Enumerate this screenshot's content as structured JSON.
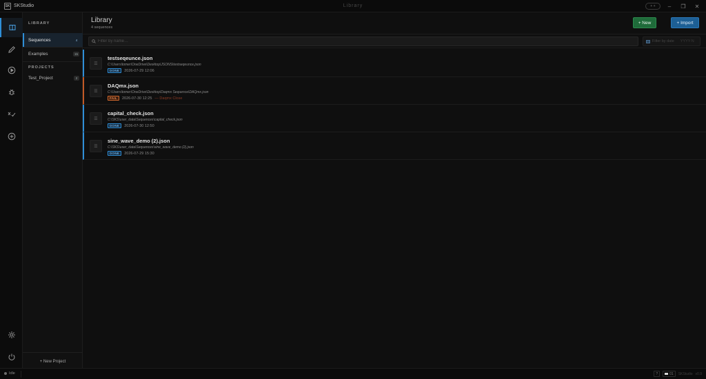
{
  "titlebar": {
    "app_logo": "SK",
    "app_name": "SKStudio",
    "window_title": "Library",
    "pill_label": "+ +",
    "minimize": "–",
    "restore": "❐",
    "close": "✕"
  },
  "rail": {
    "items": [
      {
        "name": "library",
        "icon": "book-icon"
      },
      {
        "name": "editor",
        "icon": "pencil-icon"
      },
      {
        "name": "run",
        "icon": "play-icon"
      },
      {
        "name": "debug",
        "icon": "bug-icon"
      },
      {
        "name": "test",
        "icon": "test-check-icon"
      },
      {
        "name": "add",
        "icon": "plus-circle-icon"
      },
      {
        "name": "settings",
        "icon": "gear-icon"
      },
      {
        "name": "power",
        "icon": "power-icon"
      }
    ]
  },
  "sidebar": {
    "library_heading": "LIBRARY",
    "items": [
      {
        "label": "Sequences",
        "count": "4"
      },
      {
        "label": "Examples",
        "count": "15"
      }
    ],
    "projects_heading": "PROJECTS",
    "projects": [
      {
        "label": "Test_Project",
        "count": "2"
      }
    ],
    "new_project": "+  New Project"
  },
  "header": {
    "title": "Library",
    "subtitle": "4 sequences",
    "new_label": "+ New",
    "import_label": "+ Import"
  },
  "filter": {
    "search_placeholder": "Filter by name…",
    "date_label": "Filter by date",
    "date_format": "YYYY-N"
  },
  "files": [
    {
      "name": "testseqeunce.json",
      "path": "C:\\Users\\tomer\\OneDrive\\Desktop\\JSONS\\testseqeunce.json",
      "status": "DONE",
      "date": "2026-07-29  12:06",
      "note": ""
    },
    {
      "name": "DAQmx.json",
      "path": "C:\\Users\\tomer\\OneDrive\\Desktop\\Daqmx Sequence\\DAQmx.json",
      "status": "FAIL",
      "date": "2026-07-30  12:25",
      "note": "— Daqmx Close"
    },
    {
      "name": "capital_check.json",
      "path": "C:\\SKS\\user_data\\Sequences\\capital_check.json",
      "status": "DONE",
      "date": "2026-07-30  12:50",
      "note": ""
    },
    {
      "name": "sine_wave_demo (2).json",
      "path": "C:\\SKS\\user_data\\Sequences\\sine_wave_demo (2).json",
      "status": "DONE",
      "date": "2026-07-29  15:30",
      "note": ""
    }
  ],
  "statusbar": {
    "state": "Idle",
    "box1": "?",
    "box2": "01",
    "app_label": "SKStudio",
    "version": "v0.9"
  },
  "colors": {
    "accent": "#2f8fd8",
    "new_button": "#1f6b3a",
    "import_button": "#1d5f95",
    "fail": "#d46a2e"
  }
}
